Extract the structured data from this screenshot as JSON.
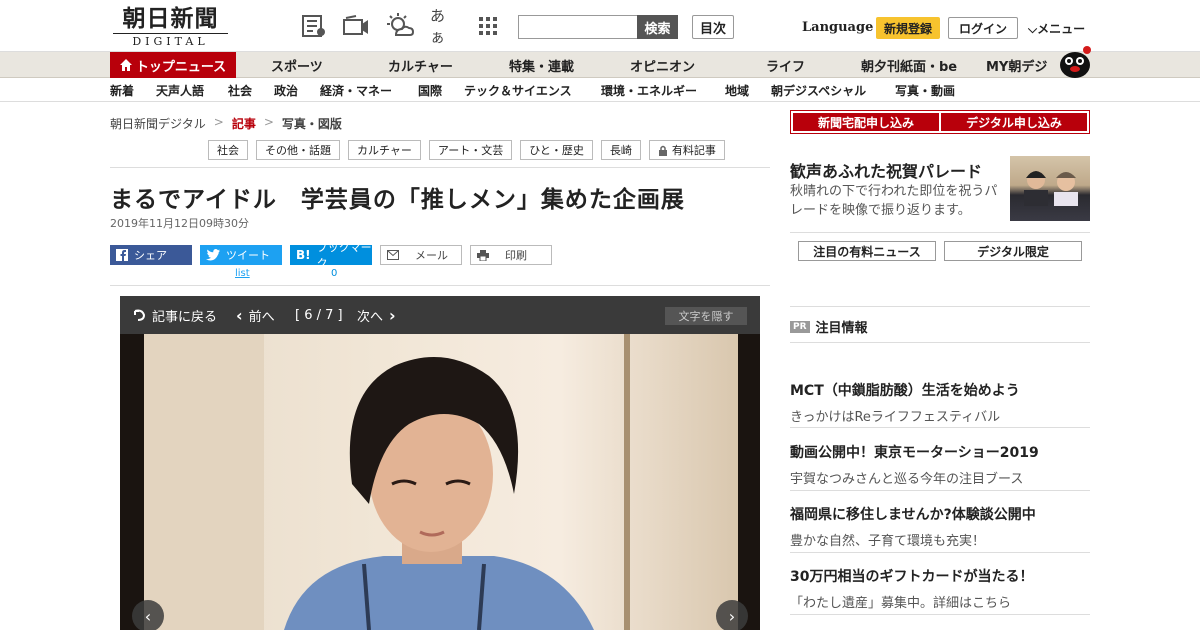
{
  "header": {
    "logo_jp": "朝日新聞",
    "logo_en": "DIGITAL",
    "font_size_label": "あぁ",
    "search_button": "検索",
    "toc_button": "目次",
    "language": "Language",
    "register": "新規登録",
    "login": "ログイン",
    "menu": "メニュー"
  },
  "main_nav": {
    "top": "トップニュース",
    "items": [
      "スポーツ",
      "カルチャー",
      "特集・連載",
      "オピニオン",
      "ライフ",
      "朝夕刊紙面・be",
      "MY朝デジ"
    ]
  },
  "sub_nav": {
    "items": [
      "新着",
      "天声人語",
      "社会",
      "政治",
      "経済・マネー",
      "国際",
      "テック＆サイエンス",
      "環境・エネルギー",
      "地域",
      "朝デジスペシャル",
      "写真・動画"
    ]
  },
  "breadcrumb": {
    "items": [
      "朝日新聞デジタル",
      "記事",
      "写真・図版"
    ],
    "sep": ">"
  },
  "tags": [
    "社会",
    "その他・話題",
    "カルチャー",
    "アート・文芸",
    "ひと・歴史",
    "長崎",
    "有料記事"
  ],
  "article": {
    "headline": "まるでアイドル　学芸員の「推しメン」集めた企画展",
    "date": "2019年11月12日09時30分"
  },
  "share": {
    "facebook": "シェア",
    "twitter": "ツイート",
    "twitter_count": "list",
    "hatena": "ブックマーク",
    "hatena_count": "0",
    "mail": "メール",
    "print": "印刷"
  },
  "viewer": {
    "back": "記事に戻る",
    "prev": "前へ",
    "counter": "[ 6 / 7 ]",
    "next": "次へ",
    "hide_text": "文字を隠す"
  },
  "sidebar": {
    "apply_home": "新聞宅配申し込み",
    "apply_digital": "デジタル申し込み",
    "feature_title": "歓声あふれた祝賀パレード",
    "feature_desc": "秋晴れの下で行われた即位を祝うパレードを映像で振り返ります。",
    "btn_paid": "注目の有料ニュース",
    "btn_digital": "デジタル限定",
    "pr_badge": "PR",
    "pr_heading": "注目情報",
    "pr_items": [
      {
        "title": "MCT（中鎖脂肪酸）生活を始めよう",
        "desc": "きっかけはReライフフェスティバル"
      },
      {
        "title": "動画公開中！東京モーターショー2019",
        "desc": "宇賀なつみさんと巡る今年の注目ブース"
      },
      {
        "title": "福岡県に移住しませんか?体験談公開中",
        "desc": "豊かな自然、子育て環境も充実！"
      },
      {
        "title": "30万円相当のギフトカードが当たる！",
        "desc": "「わたし遺産」募集中。詳細はこちら"
      }
    ]
  },
  "colors": {
    "brand_red": "#b8000b",
    "register_yellow": "#f7c32e",
    "facebook": "#3b5998",
    "twitter": "#1da1f2",
    "hatena": "#008fde"
  }
}
